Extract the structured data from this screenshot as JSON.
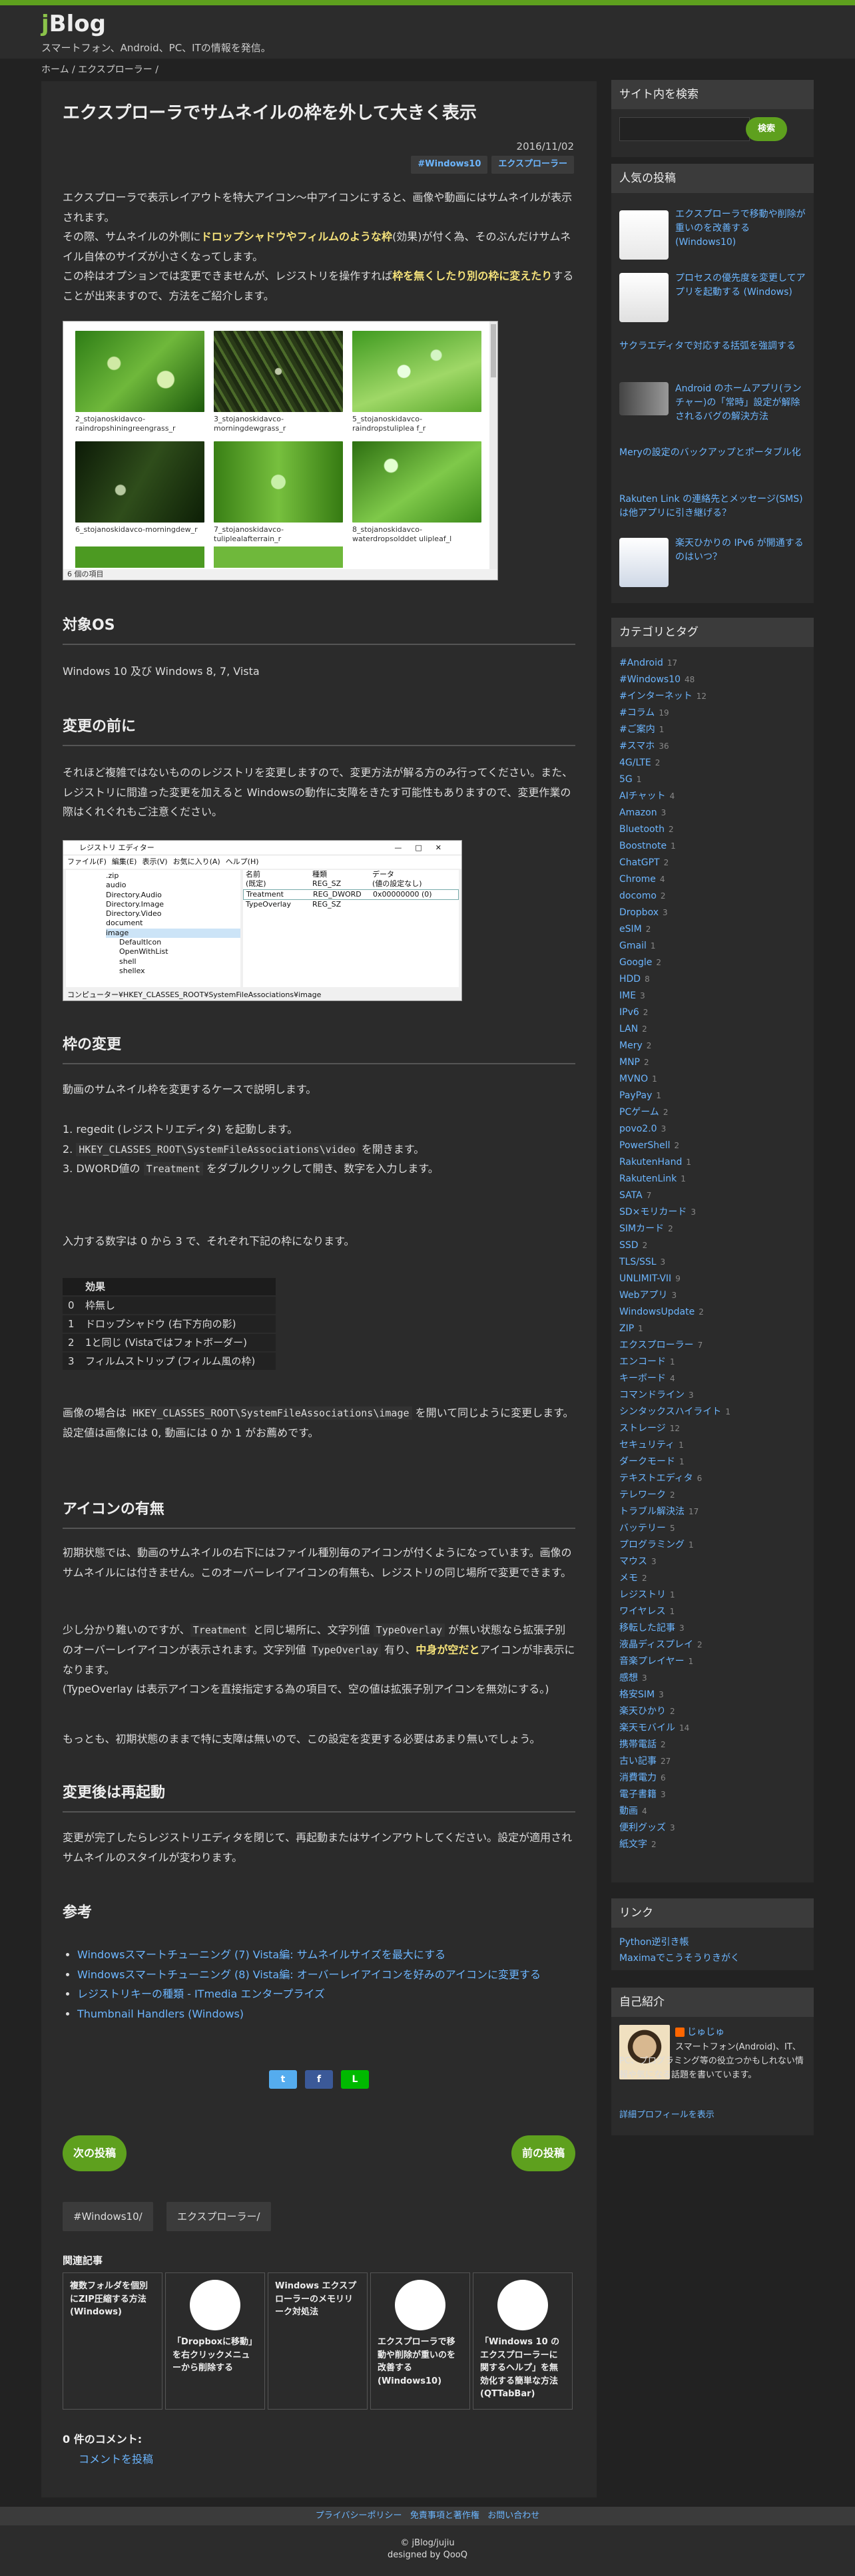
{
  "site": {
    "logo_j": "j",
    "logo_rest": "Blog",
    "tagline": "スマートフォン、Android、PC、ITの情報を発信。",
    "breadcrumb": "ホーム / エクスプローラー /"
  },
  "post": {
    "title": "エクスプローラでサムネイルの枠を外して大きく表示",
    "date": "2016/11/02",
    "tags": [
      "#Windows10",
      "エクスプローラー"
    ],
    "intro1": "エクスプローラで表示レイアウトを特大アイコン〜中アイコンにすると、画像や動画にはサムネイルが表示されます。",
    "intro2a": "その際、サムネイルの外側に",
    "intro2b": "ドロップシャドウやフィルムのような枠",
    "intro2c": "(効果)が付く為、そのぶんだけサムネイル自体のサイズが小さくなってします。",
    "intro3a": "この枠はオプションでは変更できませんが、レジストリを操作すれば",
    "intro3b": "枠を無くしたり別の枠に変えたり",
    "intro3c": "することが出来ますので、方法をご紹介します。",
    "explorer_caption": "6 個の項目",
    "thumbs": [
      "2_stojanoskidavco-raindropshiningreengrass_r",
      "3_stojanoskidavco-morningdewgrass_r",
      "5_stojanoskidavco-raindropstuliplea f_r",
      "6_stojanoskidavco-morningdew_r",
      "7_stojanoskidavco-tuliplealafterrain_r",
      "8_stojanoskidavco-waterdropsolddet ulipleaf_l"
    ],
    "h_os": "対象OS",
    "os_text": "Windows 10 及び Windows 8, 7, Vista",
    "h_before": "変更の前に",
    "before_text": "それほど複雑ではないもののレジストリを変更しますので、変更方法が解る方のみ行ってください。また、レジストリに間違った変更を加えると Windowsの動作に支障をきたす可能性もありますので、変更作業の際はくれぐれもご注意ください。",
    "regedit": {
      "title": "レジストリ エディター",
      "menu": [
        "ファイル(F)",
        "編集(E)",
        "表示(V)",
        "お気に入り(A)",
        "ヘルプ(H)"
      ],
      "tree": [
        ".zip",
        "audio",
        "Directory.Audio",
        "Directory.Image",
        "Directory.Video",
        "document",
        "image",
        "DefaultIcon",
        "OpenWithList",
        "shell",
        "shellex"
      ],
      "cols": [
        "名前",
        "種類",
        "データ"
      ],
      "rows": [
        [
          "(既定)",
          "REG_SZ",
          "(値の設定なし)"
        ],
        [
          "Treatment",
          "REG_DWORD",
          "0x00000000 (0)"
        ],
        [
          "TypeOverlay",
          "REG_SZ",
          ""
        ]
      ],
      "status": "コンピューター¥HKEY_CLASSES_ROOT¥SystemFileAssociations¥image"
    },
    "h_frame": "枠の変更",
    "frame_intro": "動画のサムネイル枠を変更するケースで説明します。",
    "step1": "1. regedit (レジストリエディタ) を起動します。",
    "step2a": "2. ",
    "step2code": "HKEY_CLASSES_ROOT\\SystemFileAssociations\\video",
    "step2b": " を開きます。",
    "step3a": "3. DWORD値の ",
    "step3code": "Treatment",
    "step3b": " をダブルクリックして開き、数字を入力します。",
    "frame_input": "入力する数字は 0 から 3 で、それぞれ下記の枠になります。",
    "table_head": "効果",
    "table": [
      [
        "0",
        "枠無し"
      ],
      [
        "1",
        "ドロップシャドウ (右下方向の影)"
      ],
      [
        "2",
        "1と同じ (Vistaではフォトボーダー)"
      ],
      [
        "3",
        "フィルムストリップ (フィルム風の枠)"
      ]
    ],
    "img_a": "画像の場合は ",
    "img_code": "HKEY_CLASSES_ROOT\\SystemFileAssociations\\image",
    "img_b": " を開いて同じように変更します。",
    "img_c": "設定値は画像には 0, 動画には 0 か 1 がお薦めです。",
    "h_icon": "アイコンの有無",
    "icon1": "初期状態では、動画のサムネイルの右下にはファイル種別毎のアイコンが付くようになっています。画像のサムネイルには付きません。このオーバーレイアイコンの有無も、レジストリの同じ場所で変更できます。",
    "icon2a": "少し分かり難いのですが、",
    "icon2code1": "Treatment",
    "icon2b": " と同じ場所に、文字列値 ",
    "icon2code2": "TypeOverlay",
    "icon2c": " が無い状態なら拡張子別のオーバーレイアイコンが表示されます。文字列値 ",
    "icon2code3": "TypeOverlay",
    "icon2d": " 有り、",
    "icon2e": "中身が空だと",
    "icon2f": "アイコンが非表示になります。",
    "icon2g": "(TypeOverlay は表示アイコンを直接指定する為の項目で、空の値は拡張子別アイコンを無効にする。)",
    "icon3": "もっとも、初期状態のままで特に支障は無いので、この設定を変更する必要はあまり無いでしょう。",
    "h_after": "変更後は再起動",
    "after_text": "変更が完了したらレジストリエディタを閉じて、再起動またはサインアウトしてください。設定が適用されサムネイルのスタイルが変わります。",
    "h_ref": "参考",
    "refs": [
      "Windowsスマートチューニング (7) Vista編: サムネイルサイズを最大にする",
      "Windowsスマートチューニング (8) Vista編: オーバーレイアイコンを好みのアイコンに変更する",
      "レジストリキーの種類 - ITmedia エンタープライズ",
      "Thumbnail Handlers (Windows)"
    ],
    "share": [
      "t",
      "f",
      "L"
    ],
    "next": "次の投稿",
    "prev": "前の投稿",
    "foot_tags": [
      "#Windows10/",
      "エクスプローラー/"
    ],
    "related_title": "関連記事",
    "related": [
      "複数フォルダを個別にZIP圧縮する方法 (Windows)",
      "「Dropboxに移動」を右クリックメニューから削除する",
      "Windows エクスプローラーのメモリリーク対処法",
      "エクスプローラで移動や削除が重いのを改善する (Windows10)",
      "「Windows 10 のエクスプローラーに関するヘルプ」を無効化する簡単な方法 (QTTabBar)"
    ],
    "comments_title": "0 件のコメント:",
    "comment_link": "コメントを投稿"
  },
  "sidebar": {
    "search_title": "サイト内を検索",
    "search_btn": "検索",
    "search_placeholder": "",
    "popular_title": "人気の投稿",
    "popular": [
      "エクスプローラで移動や削除が重いのを改善する (Windows10)",
      "プロセスの優先度を変更してアプリを起動する (Windows)",
      "サクラエディタで対応する括弧を強調する",
      "Android のホームアプリ(ランチャー)の「常時」設定が解除されるバグの解決方法",
      "Meryの設定のバックアップとポータブル化",
      "Rakuten Link の連絡先とメッセージ(SMS)は他アプリに引き継げる？",
      "楽天ひかりの IPv6 が開通するのはいつ？"
    ],
    "cat_title": "カテゴリとタグ",
    "cats": [
      [
        "#Android",
        "17"
      ],
      [
        "#Windows10",
        "48"
      ],
      [
        "#インターネット",
        "12"
      ],
      [
        "#コラム",
        "19"
      ],
      [
        "#ご案内",
        "1"
      ],
      [
        "#スマホ",
        "36"
      ],
      [
        "4G/LTE",
        "2"
      ],
      [
        "5G",
        "1"
      ],
      [
        "AIチャット",
        "4"
      ],
      [
        "Amazon",
        "3"
      ],
      [
        "Bluetooth",
        "2"
      ],
      [
        "Boostnote",
        "1"
      ],
      [
        "ChatGPT",
        "2"
      ],
      [
        "Chrome",
        "4"
      ],
      [
        "docomo",
        "2"
      ],
      [
        "Dropbox",
        "3"
      ],
      [
        "eSIM",
        "2"
      ],
      [
        "Gmail",
        "1"
      ],
      [
        "Google",
        "2"
      ],
      [
        "HDD",
        "8"
      ],
      [
        "IME",
        "3"
      ],
      [
        "IPv6",
        "2"
      ],
      [
        "LAN",
        "2"
      ],
      [
        "Mery",
        "2"
      ],
      [
        "MNP",
        "2"
      ],
      [
        "MVNO",
        "1"
      ],
      [
        "PayPay",
        "1"
      ],
      [
        "PCゲーム",
        "2"
      ],
      [
        "povo2.0",
        "3"
      ],
      [
        "PowerShell",
        "2"
      ],
      [
        "RakutenHand",
        "1"
      ],
      [
        "RakutenLink",
        "1"
      ],
      [
        "SATA",
        "7"
      ],
      [
        "SD×モリカード",
        "3"
      ],
      [
        "SIMカード",
        "2"
      ],
      [
        "SSD",
        "2"
      ],
      [
        "TLS/SSL",
        "3"
      ],
      [
        "UNLIMIT-VII",
        "9"
      ],
      [
        "Webアプリ",
        "3"
      ],
      [
        "WindowsUpdate",
        "2"
      ],
      [
        "ZIP",
        "1"
      ],
      [
        "エクスプローラー",
        "7"
      ],
      [
        "エンコード",
        "1"
      ],
      [
        "キーボード",
        "4"
      ],
      [
        "コマンドライン",
        "3"
      ],
      [
        "シンタックスハイライト",
        "1"
      ],
      [
        "ストレージ",
        "12"
      ],
      [
        "セキュリティ",
        "1"
      ],
      [
        "ダークモード",
        "1"
      ],
      [
        "テキストエディタ",
        "6"
      ],
      [
        "テレワーク",
        "2"
      ],
      [
        "トラブル解決法",
        "17"
      ],
      [
        "バッテリー",
        "5"
      ],
      [
        "プログラミング",
        "1"
      ],
      [
        "マウス",
        "3"
      ],
      [
        "メモ",
        "2"
      ],
      [
        "レジストリ",
        "1"
      ],
      [
        "ワイヤレス",
        "1"
      ],
      [
        "移転した記事",
        "3"
      ],
      [
        "液晶ディスプレイ",
        "2"
      ],
      [
        "音楽プレイヤー",
        "1"
      ],
      [
        "感想",
        "3"
      ],
      [
        "格安SIM",
        "3"
      ],
      [
        "楽天ひかり",
        "2"
      ],
      [
        "楽天モバイル",
        "14"
      ],
      [
        "携帯電話",
        "2"
      ],
      [
        "古い記事",
        "27"
      ],
      [
        "消費電力",
        "6"
      ],
      [
        "電子書籍",
        "3"
      ],
      [
        "動画",
        "4"
      ],
      [
        "便利グッズ",
        "3"
      ],
      [
        "紙文字",
        "2"
      ]
    ],
    "link_title": "リンク",
    "links": [
      "Python逆引き帳",
      "Maximaでこうそうりきがく"
    ],
    "profile_title": "自己紹介",
    "profile_name": "じゅじゅ",
    "profile_text": "スマートフォン(Android)、IT、PC、プログラミング等の役立つかもしれない情報や気になる話題を書いています。",
    "profile_link": "詳細プロフィールを表示"
  },
  "footer": {
    "links": [
      "プライバシーポリシー",
      "免責事項と著作権",
      "お問い合わせ"
    ],
    "copy": "© jBlog/jujiu",
    "credit": "designed by QooQ"
  }
}
